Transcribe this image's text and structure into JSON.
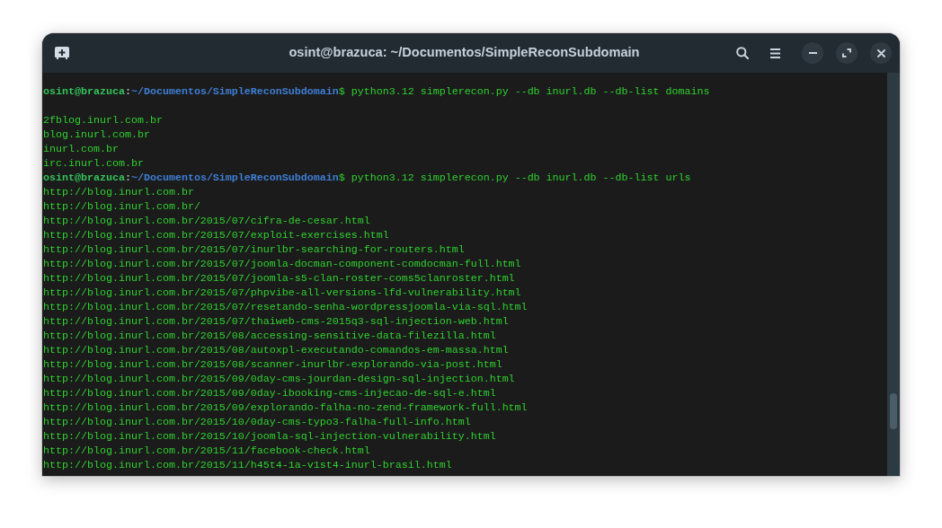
{
  "window": {
    "title": "osint@brazuca: ~/Documentos/SimpleReconSubdomain"
  },
  "terminal": {
    "lines": [
      {
        "kind": "prompt",
        "user_host": "osint@brazuca",
        "separator": ":",
        "path": "~/Documentos/SimpleReconSubdomain",
        "command": "$ python3.12 simplerecon.py --db inurl.db --db-list domains"
      },
      {
        "kind": "blank"
      },
      {
        "kind": "output",
        "text": "2fblog.inurl.com.br"
      },
      {
        "kind": "output",
        "text": "blog.inurl.com.br"
      },
      {
        "kind": "output",
        "text": "inurl.com.br"
      },
      {
        "kind": "output",
        "text": "irc.inurl.com.br"
      },
      {
        "kind": "prompt",
        "user_host": "osint@brazuca",
        "separator": ":",
        "path": "~/Documentos/SimpleReconSubdomain",
        "command": "$ python3.12 simplerecon.py --db inurl.db --db-list urls"
      },
      {
        "kind": "output",
        "text": "http://blog.inurl.com.br"
      },
      {
        "kind": "output",
        "text": "http://blog.inurl.com.br/"
      },
      {
        "kind": "output",
        "text": "http://blog.inurl.com.br/2015/07/cifra-de-cesar.html"
      },
      {
        "kind": "output",
        "text": "http://blog.inurl.com.br/2015/07/exploit-exercises.html"
      },
      {
        "kind": "output",
        "text": "http://blog.inurl.com.br/2015/07/inurlbr-searching-for-routers.html"
      },
      {
        "kind": "output",
        "text": "http://blog.inurl.com.br/2015/07/joomla-docman-component-comdocman-full.html"
      },
      {
        "kind": "output",
        "text": "http://blog.inurl.com.br/2015/07/joomla-s5-clan-roster-coms5clanroster.html"
      },
      {
        "kind": "output",
        "text": "http://blog.inurl.com.br/2015/07/phpvibe-all-versions-lfd-vulnerability.html"
      },
      {
        "kind": "output",
        "text": "http://blog.inurl.com.br/2015/07/resetando-senha-wordpressjoomla-via-sql.html"
      },
      {
        "kind": "output",
        "text": "http://blog.inurl.com.br/2015/07/thaiweb-cms-2015q3-sql-injection-web.html"
      },
      {
        "kind": "output",
        "text": "http://blog.inurl.com.br/2015/08/accessing-sensitive-data-filezilla.html"
      },
      {
        "kind": "output",
        "text": "http://blog.inurl.com.br/2015/08/autoxpl-executando-comandos-em-massa.html"
      },
      {
        "kind": "output",
        "text": "http://blog.inurl.com.br/2015/08/scanner-inurlbr-explorando-via-post.html"
      },
      {
        "kind": "output",
        "text": "http://blog.inurl.com.br/2015/09/0day-cms-jourdan-design-sql-injection.html"
      },
      {
        "kind": "output",
        "text": "http://blog.inurl.com.br/2015/09/0day-ibooking-cms-injecao-de-sql-e.html"
      },
      {
        "kind": "output",
        "text": "http://blog.inurl.com.br/2015/09/explorando-falha-no-zend-framework-full.html"
      },
      {
        "kind": "output",
        "text": "http://blog.inurl.com.br/2015/10/0day-cms-typo3-falha-full-info.html"
      },
      {
        "kind": "output",
        "text": "http://blog.inurl.com.br/2015/10/joomla-sql-injection-vulnerability.html"
      },
      {
        "kind": "output",
        "text": "http://blog.inurl.com.br/2015/11/facebook-check.html"
      },
      {
        "kind": "output",
        "text": "http://blog.inurl.com.br/2015/11/h45t4-1a-v1st4-inurl-brasil.html"
      }
    ]
  }
}
